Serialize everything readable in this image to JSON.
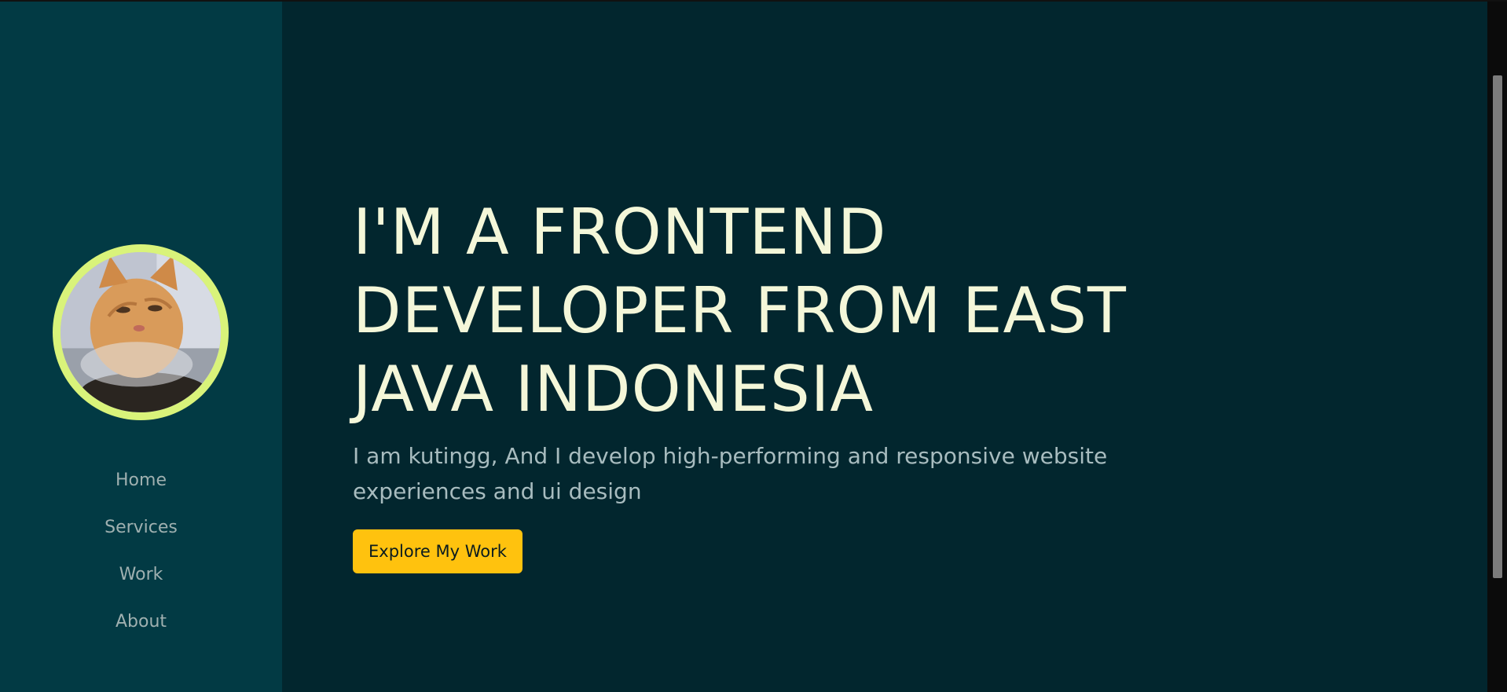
{
  "sidebar": {
    "avatar_alt": "orange cat avatar",
    "items": [
      {
        "label": "Home"
      },
      {
        "label": "Services"
      },
      {
        "label": "Work"
      },
      {
        "label": "About"
      }
    ]
  },
  "hero": {
    "heading": "I'M A FRONTEND DEVELOPER FROM EAST JAVA INDONESIA",
    "intro": "I am kutingg, And I develop high-performing and responsive website experiences and ui design",
    "cta_label": "Explore My Work"
  },
  "colors": {
    "sidebar_bg": "#023a44",
    "main_bg": "#02262e",
    "avatar_ring": "#d9f37a",
    "heading": "#f4f7d9",
    "accent_button": "#ffc20e"
  }
}
